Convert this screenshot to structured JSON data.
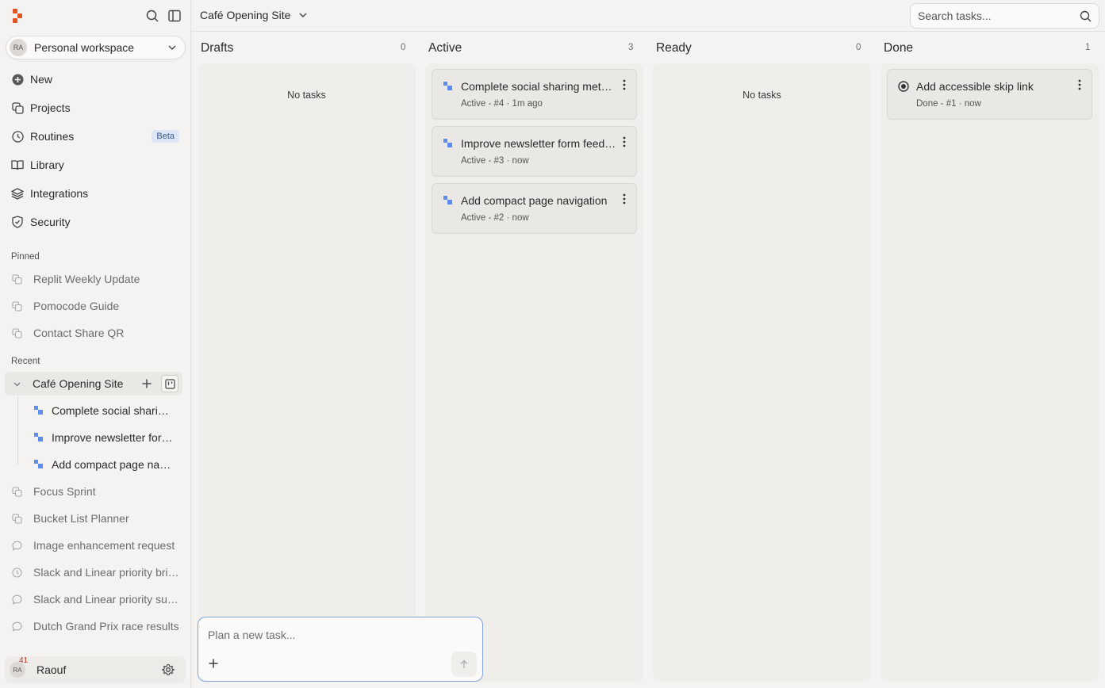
{
  "colors": {
    "accent": "#e2531f",
    "task_icon": "#5b8def",
    "beta_bg": "#dde6f6"
  },
  "sidebar": {
    "workspace": {
      "avatar": "RA",
      "label": "Personal workspace"
    },
    "nav": [
      {
        "label": "New",
        "icon": "plus-circle-icon"
      },
      {
        "label": "Projects",
        "icon": "projects-icon"
      },
      {
        "label": "Routines",
        "icon": "clock-icon",
        "badge": "Beta"
      },
      {
        "label": "Library",
        "icon": "book-icon"
      },
      {
        "label": "Integrations",
        "icon": "layers-icon"
      },
      {
        "label": "Security",
        "icon": "shield-icon"
      }
    ],
    "pinned_label": "Pinned",
    "pinned": [
      {
        "label": "Replit Weekly Update"
      },
      {
        "label": "Pomocode Guide"
      },
      {
        "label": "Contact Share QR"
      }
    ],
    "recent_label": "Recent",
    "recent_project": {
      "label": "Café Opening Site",
      "tasks": [
        {
          "label": "Complete social sharing metadata"
        },
        {
          "label": "Improve newsletter form feedback"
        },
        {
          "label": "Add compact page navigation"
        }
      ]
    },
    "recent": [
      {
        "label": "Focus Sprint",
        "icon": "projects-icon"
      },
      {
        "label": "Bucket List Planner",
        "icon": "projects-icon"
      },
      {
        "label": "Image enhancement request",
        "icon": "chat-icon"
      },
      {
        "label": "Slack and Linear priority briefing",
        "icon": "clock-icon"
      },
      {
        "label": "Slack and Linear priority summary",
        "icon": "chat-icon"
      },
      {
        "label": "Dutch Grand Prix race results",
        "icon": "chat-icon"
      }
    ],
    "user": {
      "avatar": "RA",
      "name": "Raouf",
      "notifications": "41"
    }
  },
  "header": {
    "title": "Café Opening Site",
    "search_placeholder": "Search tasks..."
  },
  "columns": [
    {
      "title": "Drafts",
      "count": "0",
      "empty_text": "No tasks"
    },
    {
      "title": "Active",
      "count": "3",
      "cards": [
        {
          "title": "Complete social sharing metadata",
          "meta": "Active - #4 · 1m ago"
        },
        {
          "title": "Improve newsletter form feedback",
          "meta": "Active - #3 · now"
        },
        {
          "title": "Add compact page navigation",
          "meta": "Active - #2 · now"
        }
      ]
    },
    {
      "title": "Ready",
      "count": "0",
      "empty_text": "No tasks"
    },
    {
      "title": "Done",
      "count": "1",
      "cards": [
        {
          "title": "Add accessible skip link",
          "meta": "Done - #1 · now"
        }
      ]
    }
  ],
  "composer": {
    "placeholder": "Plan a new task..."
  }
}
